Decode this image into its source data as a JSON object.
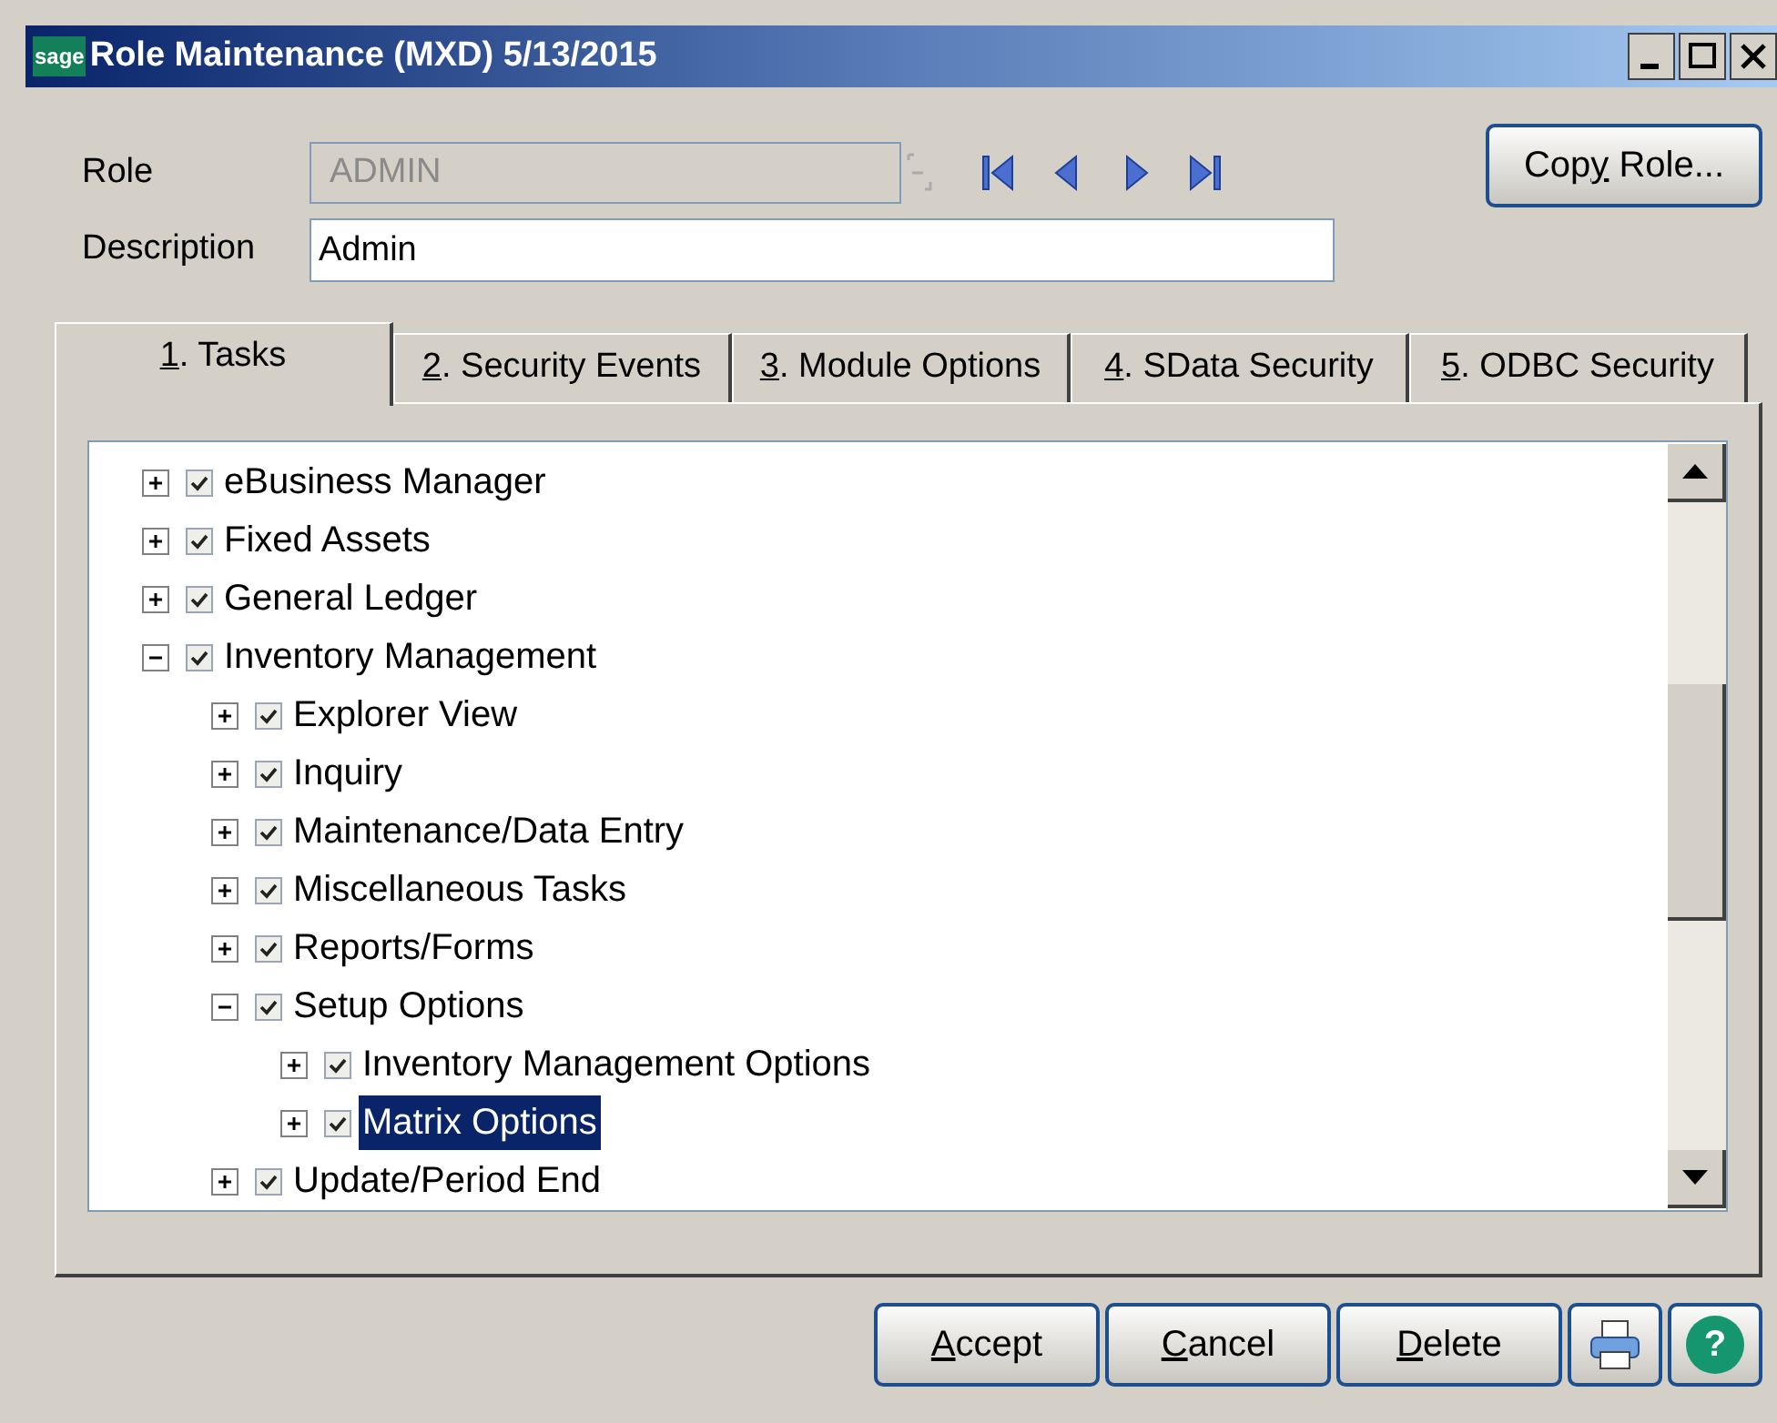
{
  "window": {
    "logo": "sage",
    "title": "Role Maintenance (MXD) 5/13/2015"
  },
  "form": {
    "role_label": "Role",
    "role_value": "ADMIN",
    "role_disabled": true,
    "description_label": "Description",
    "description_value": "Admin"
  },
  "copy_button": {
    "before": "Cop",
    "key": "y",
    "after": " Role..."
  },
  "tabs": [
    {
      "key": "1",
      "after": ". Tasks",
      "selected": true
    },
    {
      "key": "2",
      "after": ". Security Events",
      "selected": false
    },
    {
      "key": "3",
      "after": ". Module Options",
      "selected": false
    },
    {
      "key": "4",
      "after": ". SData Security",
      "selected": false
    },
    {
      "key": "5",
      "after": ". ODBC Security",
      "selected": false
    }
  ],
  "tree": [
    {
      "label": "eBusiness Manager",
      "expanded": false,
      "checked": true,
      "selected": false
    },
    {
      "label": "Fixed Assets",
      "expanded": false,
      "checked": true,
      "selected": false
    },
    {
      "label": "General Ledger",
      "expanded": false,
      "checked": true,
      "selected": false
    },
    {
      "label": "Inventory Management",
      "expanded": true,
      "checked": true,
      "selected": false,
      "children": [
        {
          "label": "Explorer View",
          "expanded": false,
          "checked": true,
          "selected": false
        },
        {
          "label": "Inquiry",
          "expanded": false,
          "checked": true,
          "selected": false
        },
        {
          "label": "Maintenance/Data Entry",
          "expanded": false,
          "checked": true,
          "selected": false
        },
        {
          "label": "Miscellaneous Tasks",
          "expanded": false,
          "checked": true,
          "selected": false
        },
        {
          "label": "Reports/Forms",
          "expanded": false,
          "checked": true,
          "selected": false
        },
        {
          "label": "Setup Options",
          "expanded": true,
          "checked": true,
          "selected": false,
          "children": [
            {
              "label": "Inventory Management Options",
              "expanded": false,
              "checked": true,
              "selected": false
            },
            {
              "label": "Matrix Options",
              "expanded": false,
              "checked": true,
              "selected": true
            }
          ]
        },
        {
          "label": "Update/Period End",
          "expanded": false,
          "checked": true,
          "selected": false
        }
      ]
    }
  ],
  "buttons": [
    {
      "key": "A",
      "after": "ccept"
    },
    {
      "key": "C",
      "after": "ancel"
    },
    {
      "key": "D",
      "after": "elete"
    }
  ],
  "help_icon": "?"
}
